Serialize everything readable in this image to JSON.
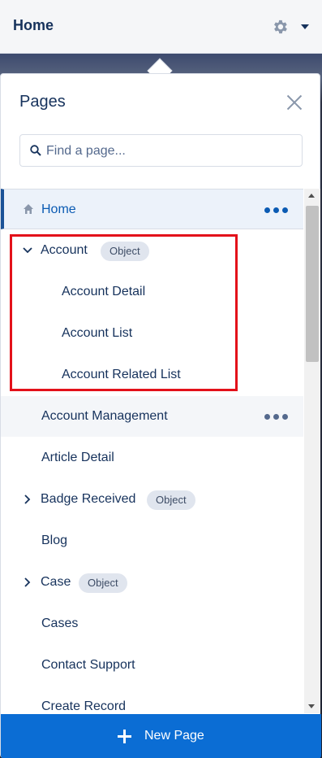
{
  "header": {
    "title": "Home",
    "icons": [
      "gear-icon",
      "chevron-down-icon"
    ]
  },
  "panel": {
    "title": "Pages",
    "search_placeholder": "Find a page...",
    "items": [
      {
        "label": "Home",
        "active": true,
        "icon": "home-icon",
        "more": true
      },
      {
        "label": "Account",
        "badge": "Object",
        "expanded": true
      },
      {
        "label": "Account Detail"
      },
      {
        "label": "Account List"
      },
      {
        "label": "Account Related List"
      },
      {
        "label": "Account Management",
        "more": true
      },
      {
        "label": "Article Detail"
      },
      {
        "label": "Badge Received",
        "badge": "Object",
        "expanded": false
      },
      {
        "label": "Blog"
      },
      {
        "label": "Case",
        "badge": "Object",
        "expanded": false
      },
      {
        "label": "Cases"
      },
      {
        "label": "Contact Support"
      },
      {
        "label": "Create Record"
      }
    ],
    "new_page_label": "New Page"
  },
  "colors": {
    "accent": "#0b6dd4",
    "highlight": "#e3111a",
    "text": "#16325c"
  }
}
